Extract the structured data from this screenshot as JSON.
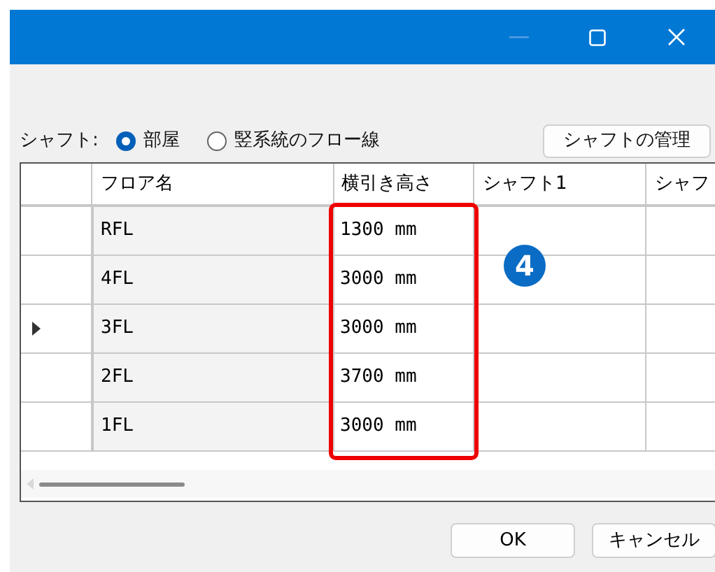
{
  "window": {
    "controls": [
      {
        "kind": "minimize",
        "disabled": true
      },
      {
        "kind": "maximize",
        "disabled": false
      },
      {
        "kind": "close",
        "disabled": false
      }
    ]
  },
  "shaft": {
    "label": "シャフト:",
    "options": [
      {
        "label": "部屋",
        "selected": true
      },
      {
        "label": "竪系統のフロー線",
        "selected": false
      }
    ],
    "manage_button": "シャフトの管理"
  },
  "table": {
    "columns": [
      "フロア名",
      "横引き高さ",
      "シャフト1",
      "シャフ"
    ],
    "rows": [
      {
        "floor": "RFL",
        "height": "1300 mm",
        "selected": false
      },
      {
        "floor": "4FL",
        "height": "3000 mm",
        "selected": false
      },
      {
        "floor": "3FL",
        "height": "3000 mm",
        "selected": true
      },
      {
        "floor": "2FL",
        "height": "3700 mm",
        "selected": false
      },
      {
        "floor": "1FL",
        "height": "3000 mm",
        "selected": false
      }
    ]
  },
  "annotation": {
    "badge": "4"
  },
  "buttons": [
    "OK",
    "キャンセル"
  ]
}
